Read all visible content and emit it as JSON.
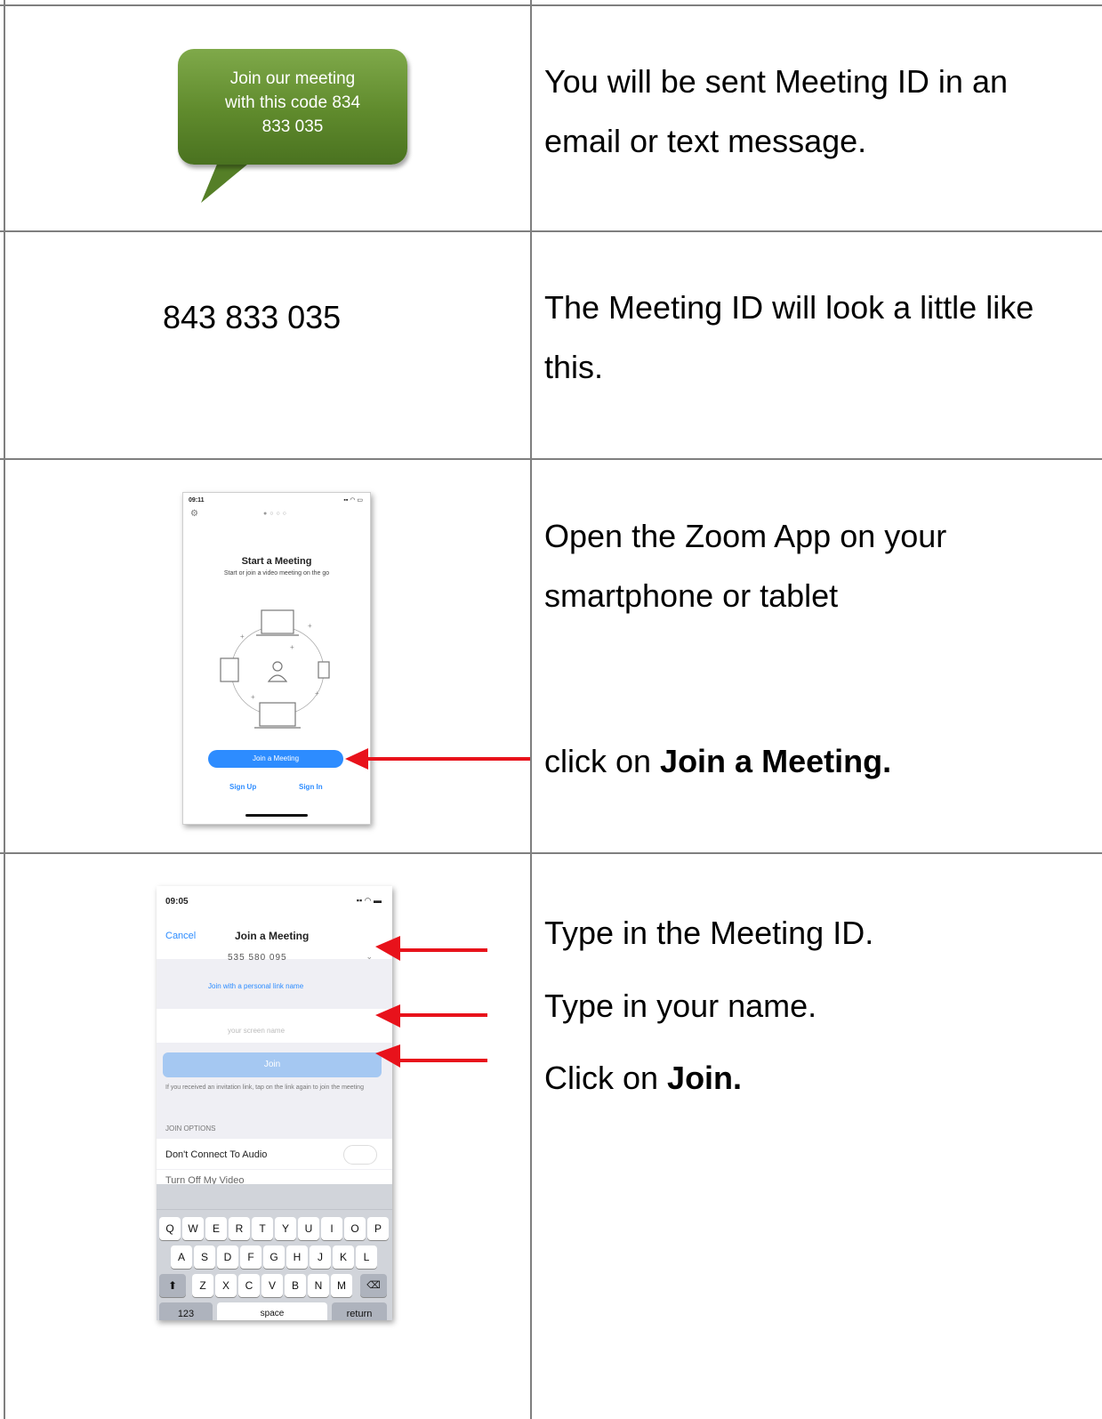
{
  "rows": [
    {
      "left": {
        "bubble_lines": [
          "Join our meeting",
          "with this code 834",
          "833 035"
        ]
      },
      "right": {
        "lines": [
          "You will be sent Meeting ID in an",
          "email or text message."
        ]
      }
    },
    {
      "left": {
        "meeting_id": "843 833 035"
      },
      "right": {
        "lines": [
          "The Meeting ID will look a little like",
          "this."
        ]
      }
    },
    {
      "left": {
        "phone": {
          "time": "09:11",
          "title": "Start a Meeting",
          "subtitle": "Start or join a video meeting on the go",
          "join_button": "Join a Meeting",
          "sign_up": "Sign Up",
          "sign_in": "Sign In"
        }
      },
      "right": {
        "lines": [
          "Open the Zoom App on your",
          "smartphone or tablet"
        ],
        "click_prefix": "click on ",
        "click_bold": "Join a Meeting."
      }
    },
    {
      "left": {
        "phone": {
          "time": "09:05",
          "cancel": "Cancel",
          "title": "Join a Meeting",
          "meeting_id_value": "535 580 095",
          "personal_link": "Join with a personal link name",
          "name_placeholder": "your screen name",
          "join_button": "Join",
          "invite_note": "If you received an invitation link, tap on the link again to join the meeting",
          "options_header": "JOIN OPTIONS",
          "option_audio": "Don't Connect To Audio",
          "option_video": "Turn Off My Video",
          "keyboard_row1": [
            "Q",
            "W",
            "E",
            "R",
            "T",
            "Y",
            "U",
            "I",
            "O",
            "P"
          ],
          "keyboard_row2": [
            "A",
            "S",
            "D",
            "F",
            "G",
            "H",
            "J",
            "K",
            "L"
          ],
          "keyboard_row3": [
            "Z",
            "X",
            "C",
            "V",
            "B",
            "N",
            "M"
          ],
          "key_123": "123",
          "key_space": "space",
          "key_return": "return"
        }
      },
      "right": {
        "line1": "Type in the Meeting ID.",
        "line2": "Type in your name.",
        "click_prefix": "Click on ",
        "click_bold": "Join."
      }
    }
  ]
}
